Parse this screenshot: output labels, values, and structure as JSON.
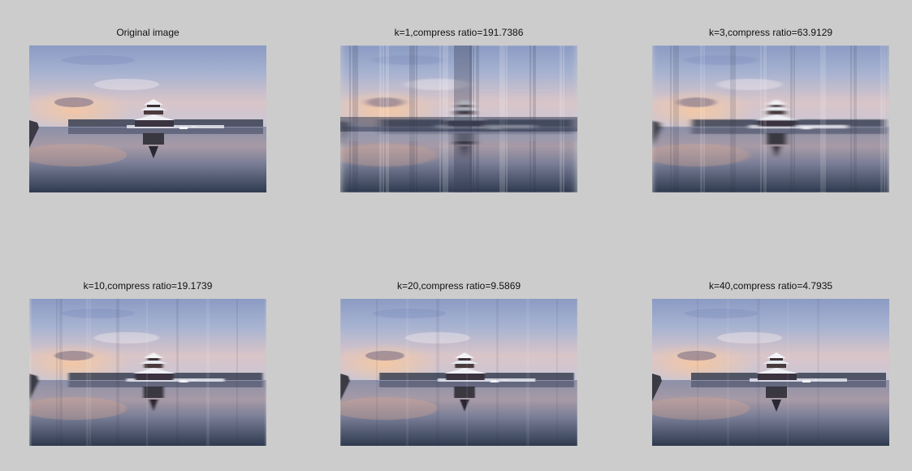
{
  "figure": {
    "panels": [
      {
        "title": "Original image",
        "k": null,
        "blur_level": 0
      },
      {
        "title": "k=1,compress ratio=191.7386",
        "k": 1,
        "blur_level": 1
      },
      {
        "title": "k=3,compress ratio=63.9129",
        "k": 3,
        "blur_level": 0.72
      },
      {
        "title": "k=10,compress ratio=19.1739",
        "k": 10,
        "blur_level": 0.35
      },
      {
        "title": "k=20,compress ratio=9.5869",
        "k": 20,
        "blur_level": 0.18
      },
      {
        "title": "k=40,compress ratio=4.7935",
        "k": 40,
        "blur_level": 0.08
      }
    ]
  }
}
